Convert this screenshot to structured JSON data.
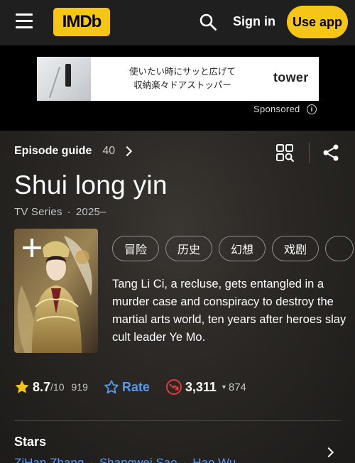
{
  "header": {
    "logo_text": "IMDb",
    "signin_label": "Sign in",
    "useapp_label": "Use app",
    "accent_color": "#f5c518"
  },
  "ad": {
    "line1": "使いたい時にサッと広げて",
    "line2": "収納楽々ドアストッパー",
    "brand": "tower",
    "sponsored_label": "Sponsored"
  },
  "title_section": {
    "episode_guide_label": "Episode guide",
    "episode_count": "40",
    "title": "Shui long yin",
    "type": "TV Series",
    "years": "2025–",
    "genres": [
      "冒险",
      "历史",
      "幻想",
      "戏剧",
      ""
    ],
    "description": "Tang Li Ci, a recluse, gets entangled in a murder case and conspiracy to destroy the martial arts world, ten years after heroes slay cult leader Ye Mo."
  },
  "ratings": {
    "score": "8.7",
    "scale": "/10",
    "votes": "919",
    "rate_label": "Rate",
    "popularity": "3,311",
    "popularity_change": "874",
    "star_color": "#f5c518",
    "rate_color": "#5799ef",
    "popularity_icon_color": "#e0393e"
  },
  "stars": {
    "heading": "Stars",
    "names": [
      "ZiHan Zhang",
      "Shangwei Sao",
      "Hao Wu"
    ]
  }
}
